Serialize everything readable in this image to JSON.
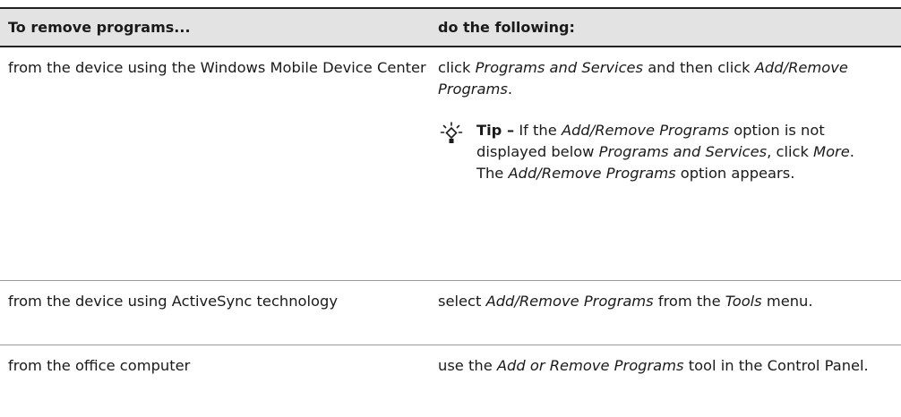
{
  "header": {
    "col1": "To remove programs...",
    "col2": "do the following:"
  },
  "rows": [
    {
      "from": "from the device using the Windows Mobile Device Center",
      "action": {
        "t1": "click ",
        "e1": "Programs and Services",
        "t2": " and then click ",
        "e2": "Add/Remove Programs",
        "t3": "."
      },
      "tip": {
        "label": "Tip –",
        "t1": " If the ",
        "e1": "Add/Remove Programs",
        "t2": " option is not displayed below ",
        "e2": "Programs and Services",
        "t3": ", click ",
        "e3": "More",
        "t4": ". The ",
        "e4": "Add/Remove Programs",
        "t5": " option appears."
      }
    },
    {
      "from": "from the device using ActiveSync technology",
      "action": {
        "t1": "select ",
        "e1": "Add/Remove Programs",
        "t2": " from the ",
        "e2": "Tools",
        "t3": " menu."
      }
    },
    {
      "from": "from the office computer",
      "action": {
        "t1": "use the ",
        "e1": "Add or Remove Programs",
        "t2": " tool in the Control Panel."
      }
    }
  ],
  "icons": {
    "tip": "lightbulb-icon"
  }
}
